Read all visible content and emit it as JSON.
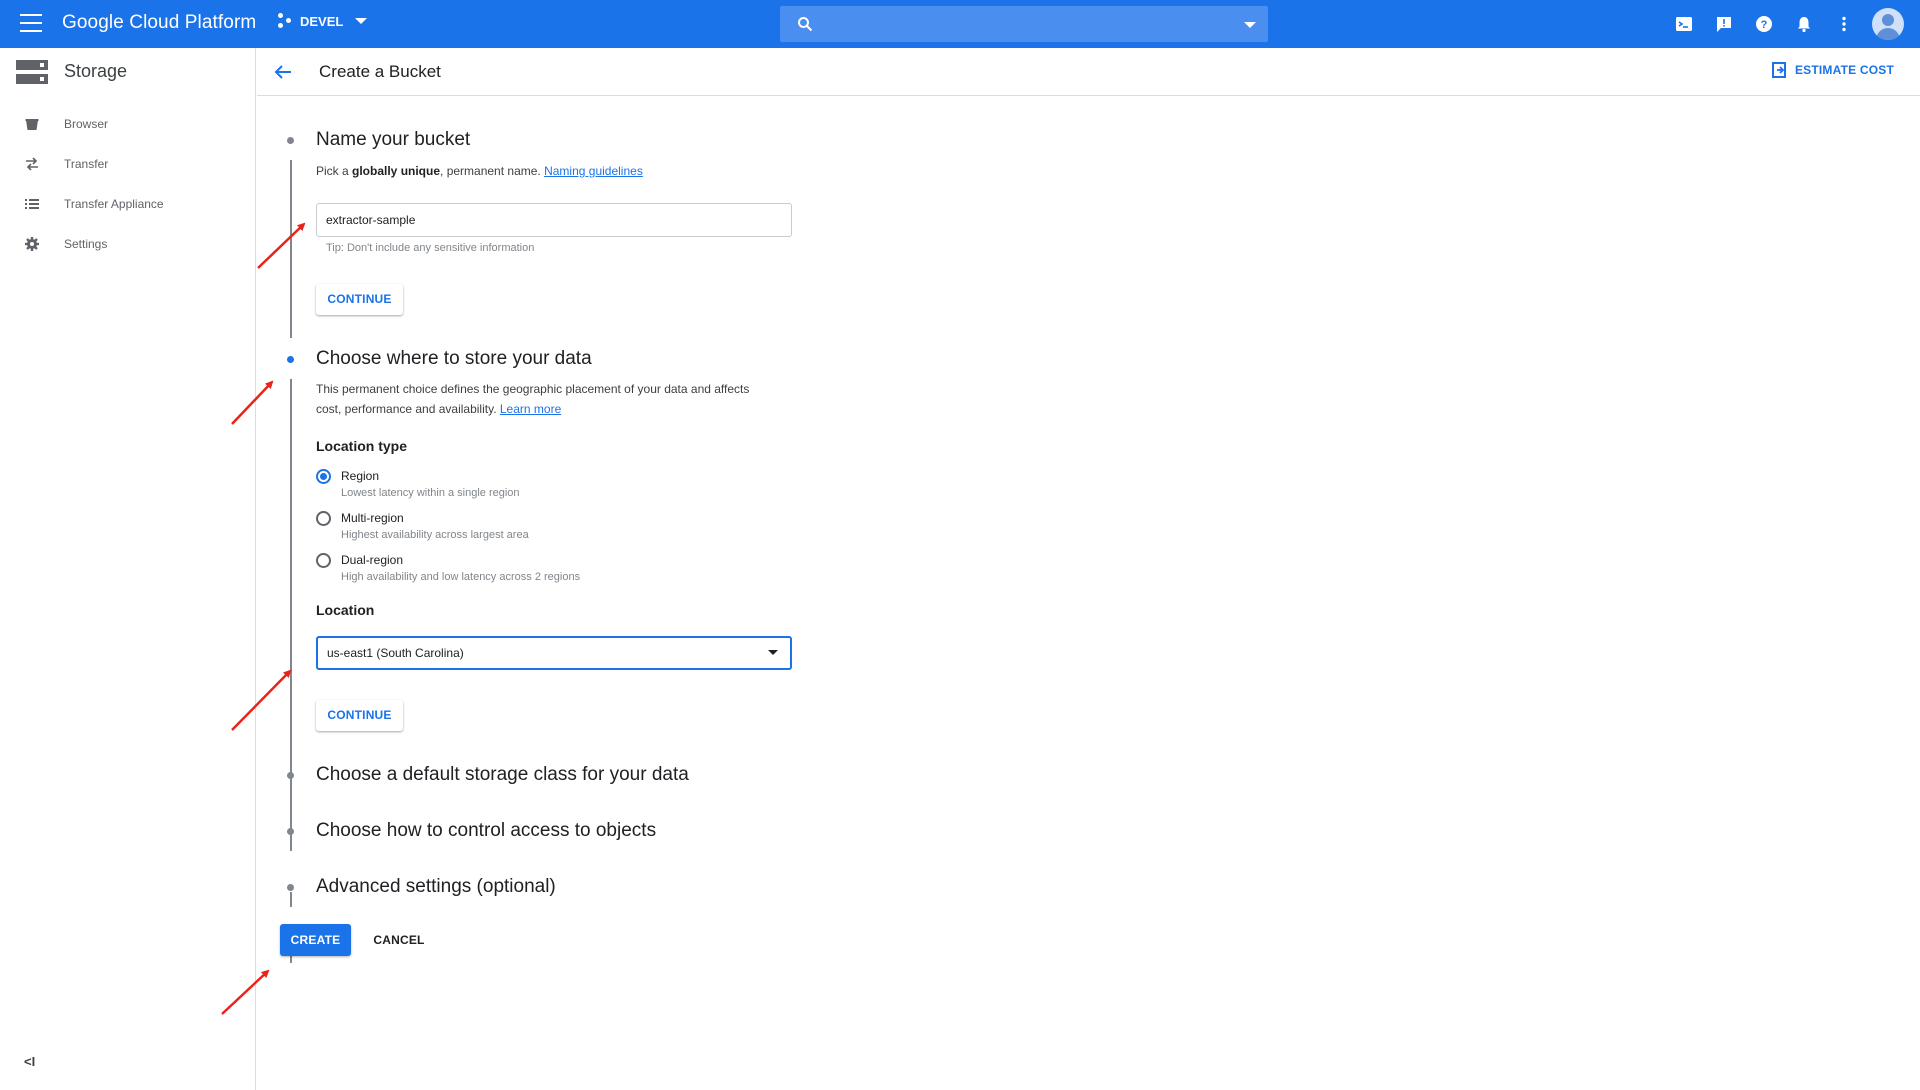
{
  "topbar": {
    "brand": "Google Cloud Platform",
    "project": "DEVEL",
    "search_placeholder": ""
  },
  "sidebar": {
    "title": "Storage",
    "items": [
      {
        "label": "Browser",
        "icon": "bucket-icon"
      },
      {
        "label": "Transfer",
        "icon": "transfer-icon"
      },
      {
        "label": "Transfer Appliance",
        "icon": "list-icon"
      },
      {
        "label": "Settings",
        "icon": "gear-icon"
      }
    ],
    "collapse_label": "<I"
  },
  "header": {
    "title": "Create a Bucket",
    "estimate_label": "ESTIMATE COST"
  },
  "steps": {
    "name": {
      "title": "Name your bucket",
      "desc_prefix": "Pick a ",
      "desc_bold": "globally unique",
      "desc_suffix": ", permanent name. ",
      "link": "Naming guidelines",
      "input_value": "extractor-sample",
      "tip": "Tip: Don't include any sensitive information",
      "continue_label": "CONTINUE"
    },
    "location": {
      "title": "Choose where to store your data",
      "desc_line1": "This permanent choice defines the geographic placement of your data and affects",
      "desc_line2": "cost, performance and availability. ",
      "link": "Learn more",
      "type_label": "Location type",
      "options": [
        {
          "label": "Region",
          "sub": "Lowest latency within a single region",
          "checked": true
        },
        {
          "label": "Multi-region",
          "sub": "Highest availability across largest area",
          "checked": false
        },
        {
          "label": "Dual-region",
          "sub": "High availability and low latency across 2 regions",
          "checked": false
        }
      ],
      "location_label": "Location",
      "location_value": "us-east1 (South Carolina)",
      "continue_label": "CONTINUE"
    },
    "storage_class": {
      "title": "Choose a default storage class for your data"
    },
    "access": {
      "title": "Choose how to control access to objects"
    },
    "advanced": {
      "title": "Advanced settings (optional)"
    }
  },
  "actions": {
    "create_label": "CREATE",
    "cancel_label": "CANCEL"
  },
  "colors": {
    "primary": "#1a73e8",
    "annotation_arrow": "#e8231a"
  }
}
